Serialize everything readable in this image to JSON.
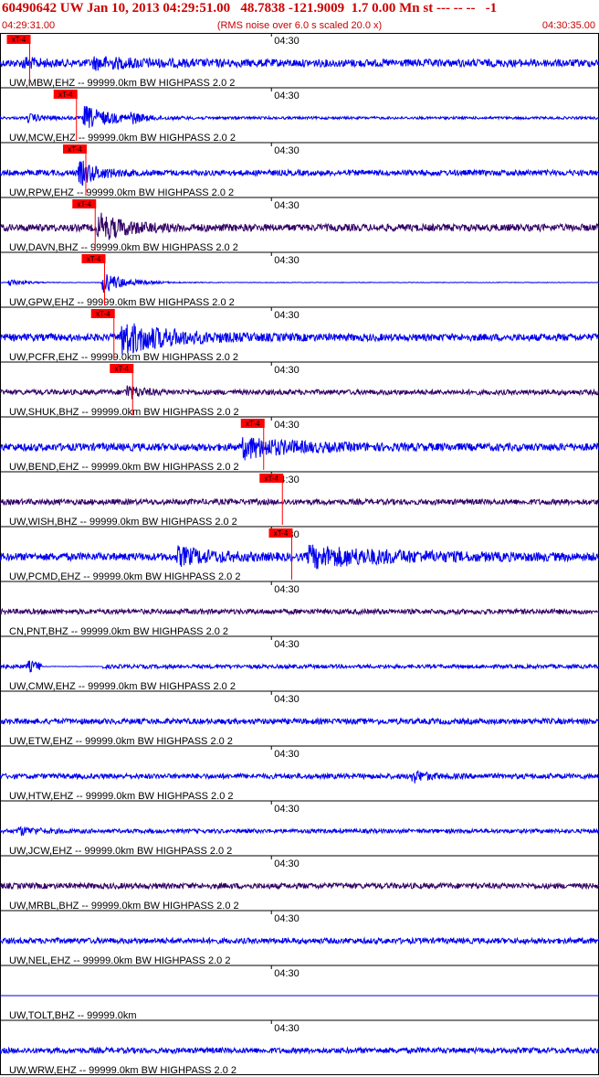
{
  "header": {
    "title": "60490642 UW Jan 10, 2013 04:29:51.00   48.7838 -121.9009  1.7 0.00 Mn st --- -- --   -1",
    "start_time": "04:29:31.00",
    "note": "(RMS noise over 6.0 s scaled 20.0 x)",
    "end_time": "04:30:35.00"
  },
  "chart_data": {
    "type": "line",
    "time_range": [
      "04:29:31.00",
      "04:30:35.00"
    ],
    "time_marker": "04:30",
    "pick_label": "xT-4",
    "colors": {
      "header": "#cc0000",
      "grid": "#000000",
      "pick": "#ff0000",
      "blue_trace": "#0000ee",
      "dark_trace": "#330066"
    },
    "traces": [
      {
        "label": "UW,MBW,EHZ -- 99999.0km BW  HIGHPASS  2.0  2",
        "pick": "04:29:33",
        "color": "#0000ee",
        "amp": 0.3,
        "events": [
          {
            "t": "04:29:33.5",
            "a": 0.35,
            "d": 1.5
          },
          {
            "t": "04:29:41",
            "a": 0.35,
            "d": 5
          }
        ]
      },
      {
        "label": "UW,MCW,EHZ -- 99999.0km BW  HIGHPASS  2.0  2",
        "pick": "04:29:38",
        "color": "#0000ee",
        "amp": 0.1,
        "events": [
          {
            "t": "04:29:34",
            "a": 0.3,
            "d": 2
          },
          {
            "t": "04:29:40",
            "a": 0.9,
            "d": 3
          },
          {
            "t": "04:29:45",
            "a": 0.35,
            "d": 1
          }
        ]
      },
      {
        "label": "UW,RPW,EHZ -- 99999.0km BW  HIGHPASS  2.0  2",
        "pick": "04:29:39",
        "color": "#0000ee",
        "amp": 0.22,
        "events": [
          {
            "t": "04:29:39.5",
            "a": 0.9,
            "d": 2
          }
        ]
      },
      {
        "label": "UW,DAVN,BHZ -- 99999.0km BW  HIGHPASS  2.0  2",
        "pick": "04:29:40",
        "color": "#330066",
        "amp": 0.28,
        "events": [
          {
            "t": "04:29:41.5",
            "a": 1.0,
            "d": 3
          }
        ]
      },
      {
        "label": "UW,GPW,EHZ -- 99999.0km BW  HIGHPASS  2.0  2",
        "pick": "04:29:41",
        "color": "#0000ee",
        "amp": 0.02,
        "events": [
          {
            "t": "04:29:32",
            "a": 0.35,
            "d": 1.5
          },
          {
            "t": "04:29:42",
            "a": 0.85,
            "d": 2.5
          }
        ]
      },
      {
        "label": "UW,PCFR,EHZ -- 99999.0km BW  HIGHPASS  2.0  2",
        "pick": "04:29:42",
        "color": "#0000ee",
        "amp": 0.28,
        "events": [
          {
            "t": "04:29:44",
            "a": 1.3,
            "d": 5
          }
        ]
      },
      {
        "label": "UW,SHUK,BHZ -- 99999.0km BW  HIGHPASS  2.0  2",
        "pick": "04:29:44",
        "color": "#330066",
        "amp": 0.2,
        "events": [
          {
            "t": "04:29:44.5",
            "a": 0.55,
            "d": 1.5
          }
        ]
      },
      {
        "label": "UW,BEND,EHZ -- 99999.0km BW  HIGHPASS  2.0  2",
        "pick": "04:29:58",
        "color": "#0000ee",
        "amp": 0.3,
        "events": [
          {
            "t": "04:29:57",
            "a": 0.75,
            "d": 5
          }
        ]
      },
      {
        "label": "UW,WISH,BHZ -- 99999.0km BW  HIGHPASS  2.0  2",
        "pick": "04:30:00",
        "color": "#330066",
        "amp": 0.22,
        "events": []
      },
      {
        "label": "UW,PCMD,EHZ -- 99999.0km BW  HIGHPASS  2.0  2",
        "pick": "04:30:01",
        "color": "#0000ee",
        "amp": 0.3,
        "events": [
          {
            "t": "04:29:50",
            "a": 0.6,
            "d": 4
          },
          {
            "t": "04:30:04",
            "a": 0.7,
            "d": 10
          }
        ]
      },
      {
        "label": "CN,PNT,BHZ -- 99999.0km BW  HIGHPASS  2.0  2",
        "pick": "",
        "color": "#330066",
        "amp": 0.2,
        "events": []
      },
      {
        "label": "UW,CMW,EHZ -- 99999.0km BW  HIGHPASS  2.0  2",
        "pick": "",
        "color": "#0000ee",
        "amp": 0.15,
        "events": [
          {
            "t": "04:29:34",
            "a": 0.35,
            "d": 2
          }
        ],
        "flat": [
          [
            "04:29:35.5",
            "04:29:42"
          ]
        ]
      },
      {
        "label": "UW,ETW,EHZ -- 99999.0km BW  HIGHPASS  2.0  2",
        "pick": "",
        "color": "#0000ee",
        "amp": 0.22,
        "events": []
      },
      {
        "label": "UW,HTW,EHZ -- 99999.0km BW  HIGHPASS  2.0  2",
        "pick": "",
        "color": "#0000ee",
        "amp": 0.2,
        "events": [
          {
            "t": "04:30:15",
            "a": 0.45,
            "d": 1.5
          }
        ]
      },
      {
        "label": "UW,JCW,EHZ -- 99999.0km BW  HIGHPASS  2.0  2",
        "pick": "",
        "color": "#0000ee",
        "amp": 0.16,
        "events": [
          {
            "t": "04:29:33",
            "a": 0.3,
            "d": 2
          }
        ]
      },
      {
        "label": "UW,MRBL,BHZ -- 99999.0km BW  HIGHPASS  2.0  2",
        "pick": "",
        "color": "#330066",
        "amp": 0.22,
        "events": []
      },
      {
        "label": "UW,NEL,EHZ -- 99999.0km BW  HIGHPASS  2.0  2",
        "pick": "",
        "color": "#0000ee",
        "amp": 0.22,
        "events": []
      },
      {
        "label": "UW,TOLT,BHZ -- 99999.0km",
        "pick": "",
        "color": "#0000ee",
        "amp": 0,
        "events": []
      },
      {
        "label": "UW,WRW,EHZ -- 99999.0km BW  HIGHPASS  2.0  2",
        "pick": "",
        "color": "#0000ee",
        "amp": 0.22,
        "events": []
      }
    ]
  }
}
